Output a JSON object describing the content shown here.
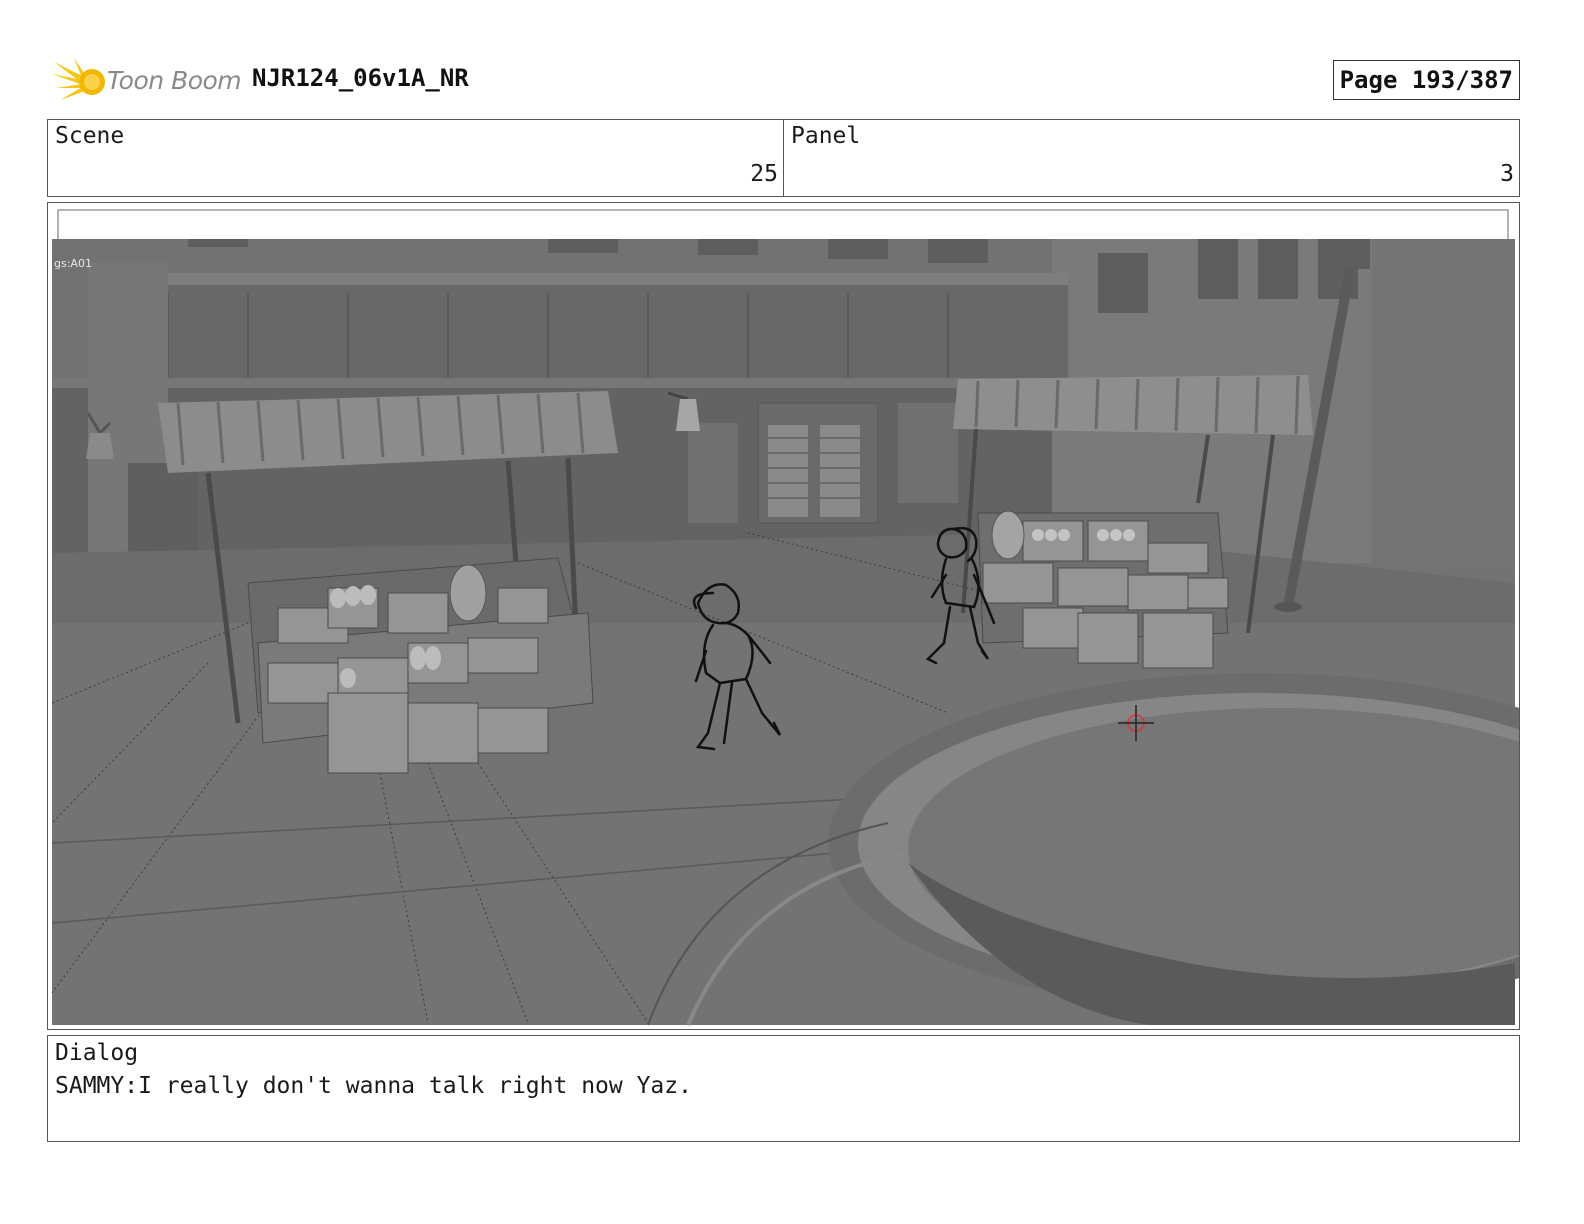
{
  "header": {
    "brand": "Toon Boom",
    "project_title": "NJR124_06v1A_NR",
    "page_label": "Page 193/387"
  },
  "scene": {
    "label": "Scene",
    "value": "25"
  },
  "panel": {
    "label": "Panel",
    "value": "3"
  },
  "frame": {
    "camera_tag": "gs:A01",
    "logo_icon": "toon-boom-starburst-icon"
  },
  "dialog": {
    "label": "Dialog",
    "line": "SAMMY:I really don't wanna talk right now Yaz."
  }
}
